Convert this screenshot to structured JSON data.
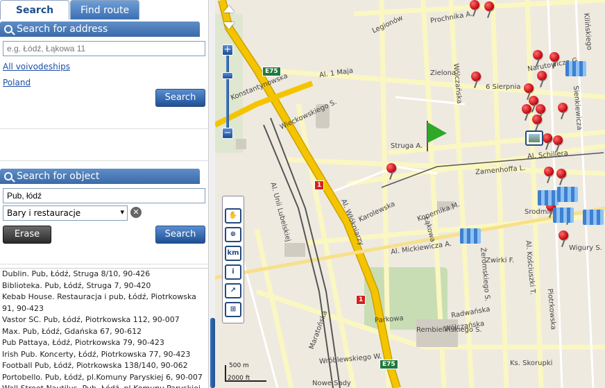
{
  "tabs": {
    "search": "Search",
    "find_route": "Find route"
  },
  "address": {
    "header": "Search for address",
    "placeholder": "e.g. Łódź, Łąkowa 11",
    "link1": "All voivodeships",
    "link2": "Poland",
    "search_button": "Search"
  },
  "object": {
    "header": "Search for object",
    "query": "Pub, łódź",
    "category": "Bary i restauracje",
    "erase_button": "Erase",
    "search_button": "Search"
  },
  "results": [
    "Dublin. Pub, Łódź, Struga 8/10, 90-426",
    "Biblioteka. Pub, Łódź, Struga 7, 90-420",
    "Kebab House. Restauracja i pub, Łódź, Piotrkowska",
    "91, 90-423",
    "Vastor SC. Pub, Łódź, Piotrkowska 112, 90-007",
    "Max. Pub, Łódź, Gdańska 67, 90-612",
    "Pub Pattaya, Łódź, Piotrkowska 79, 90-423",
    "Irish Pub. Koncerty, Łódź, Piotrkowska 77, 90-423",
    "Football Pub, Łódź, Piotrkowska 138/140, 90-062",
    "Portobello. Pub, Łódź, pl.Komuny Paryskiej 6, 90-007",
    "Wall Street Nautilus. Pub, Łódź, pl.Komuny Paryskiej"
  ],
  "map": {
    "streets": [
      "Prochnika A.",
      "Legionów",
      "Zielona",
      "Struga A.",
      "Zamenhoffa L.",
      "Al. Mickiewicza A.",
      "Karolewska",
      "Al. Włókniarzy",
      "Konstantynowska",
      "Wólczańska",
      "Piotrkowska",
      "Łąkowa",
      "Żeromskiego S.",
      "Al. Kościuszki T.",
      "Radwańska",
      "Wólczańska",
      "Al. Schillera",
      "Narutowicza G.",
      "Kilińskiego",
      "Sienkiewicza",
      "Wróblewskiego W.",
      "Parkowa",
      "Maratońska",
      "Nowe Sady",
      "Ks. Skorupki",
      "Wieckowskiego S.",
      "Al. 1 Maja",
      "6 Sierpnia",
      "Zwirki F.",
      "Wigury S.",
      "Srodmiejska",
      "Al. Unii Lubelskiej",
      "Kopernika M.",
      "Rembielińskiego S."
    ],
    "road_badges": [
      "E75",
      "1",
      "1",
      "E75"
    ],
    "scale_m": "500 m",
    "scale_ft": "2000 ft",
    "tools": [
      "hand",
      "zoom",
      "km",
      "info",
      "route",
      "grid"
    ]
  },
  "colors": {
    "accent": "#3a6aa9",
    "road_major": "#f5c400",
    "road_minor": "#fbf7c2",
    "park": "#c8ddb4"
  }
}
